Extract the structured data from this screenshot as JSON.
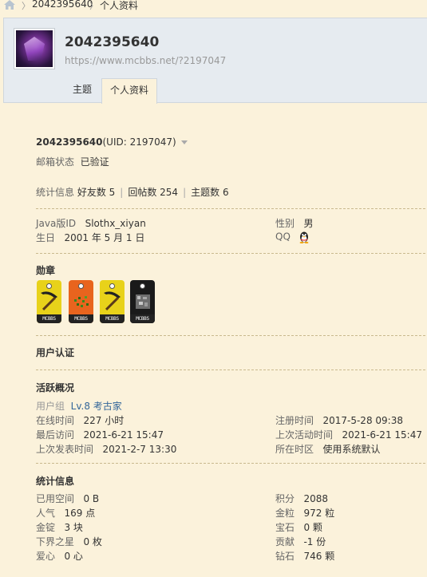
{
  "breadcrumb": {
    "items": [
      "2042395640",
      "个人资料"
    ]
  },
  "header": {
    "username": "2042395640",
    "url": "https://www.mcbbs.net/?2197047",
    "tabs": [
      {
        "label": "主题",
        "active": false
      },
      {
        "label": "个人资料",
        "active": true
      }
    ]
  },
  "profile": {
    "name": "2042395640",
    "uid": "(UID: 2197047)",
    "email_status_label": "邮箱状态",
    "email_status_value": "已验证",
    "stats_label": "统计信息",
    "friends": "好友数 5",
    "replies": "回帖数 254",
    "threads": "主题数 6",
    "java_id_label": "Java版ID",
    "java_id_value": "Slothx_xiyan",
    "birthday_label": "生日",
    "birthday_value": "2001 年 5 月 1 日",
    "gender_label": "性别",
    "gender_value": "男",
    "qq_label": "QQ"
  },
  "medals": {
    "title": "勋章",
    "items": [
      {
        "name": "pickaxe-medal",
        "color": "#e8d21a",
        "tag": "MCBBS"
      },
      {
        "name": "seeds-medal",
        "color": "#e8641e",
        "tag": "MCBBS"
      },
      {
        "name": "pickaxe-medal-2",
        "color": "#e8d21a",
        "tag": "MCBBS"
      },
      {
        "name": "ore-medal",
        "color": "#1a1a1a",
        "tag": "MCBBS"
      }
    ]
  },
  "verification": {
    "title": "用户认证"
  },
  "activity": {
    "title": "活跃概况",
    "group_label": "用户组",
    "group_value": "Lv.8 考古家",
    "online_label": "在线时间",
    "online_value": "227 小时",
    "register_label": "注册时间",
    "register_value": "2017-5-28 09:38",
    "last_visit_label": "最后访问",
    "last_visit_value": "2021-6-21 15:47",
    "last_active_label": "上次活动时间",
    "last_active_value": "2021-6-21 15:47",
    "last_post_label": "上次发表时间",
    "last_post_value": "2021-2-7 13:30",
    "timezone_label": "所在时区",
    "timezone_value": "使用系统默认"
  },
  "statistics": {
    "title": "统计信息",
    "space_label": "已用空间",
    "space_value": "0 B",
    "points_label": "积分",
    "points_value": "2088",
    "popularity_label": "人气",
    "popularity_value": "169 点",
    "nuggets_label": "金粒",
    "nuggets_value": "972 粒",
    "ingots_label": "金锭",
    "ingots_value": "3 块",
    "gems_label": "宝石",
    "gems_value": "0 颗",
    "nether_star_label": "下界之星",
    "nether_star_value": "0 枚",
    "contribution_label": "贡献",
    "contribution_value": "-1 份",
    "love_label": "爱心",
    "love_value": "0 心",
    "diamond_label": "钻石",
    "diamond_value": "746 颗"
  },
  "colors": {
    "background": "#fbf2db",
    "header": "#e6ebf0",
    "link": "#336699",
    "divider": "#c9b98e"
  }
}
